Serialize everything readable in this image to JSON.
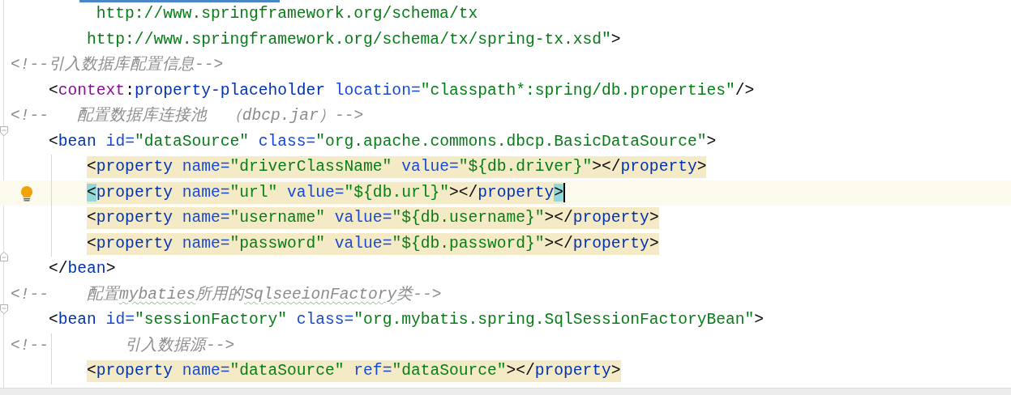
{
  "editor": {
    "lines": [
      {
        "tokens": [
          {
            "kind": "value",
            "text": "         http://www.springframework.org/schema/tx"
          }
        ]
      },
      {
        "tokens": [
          {
            "kind": "value",
            "text": "        http://www.springframework.org/schema/tx/spring-tx.xsd\""
          },
          {
            "kind": "punct",
            "text": ">"
          }
        ]
      },
      {
        "tokens": [
          {
            "kind": "comment",
            "text": "<!--引入数据库配置信息-->"
          }
        ]
      },
      {
        "tokens": [
          {
            "kind": "punct",
            "text": "    <"
          },
          {
            "kind": "namespace",
            "text": "context"
          },
          {
            "kind": "punct",
            "text": ":"
          },
          {
            "kind": "tag",
            "text": "property-placeholder"
          },
          {
            "kind": "attr",
            "text": " location="
          },
          {
            "kind": "value",
            "text": "\"classpath*:spring/db.properties\""
          },
          {
            "kind": "punct",
            "text": "/>"
          }
        ]
      },
      {
        "tokens": [
          {
            "kind": "comment",
            "text": "<!--   配置数据库连接池  （dbcp.jar）-->"
          }
        ]
      },
      {
        "fold_start": true,
        "tokens": [
          {
            "kind": "punct",
            "text": "    <"
          },
          {
            "kind": "tag",
            "text": "bean"
          },
          {
            "kind": "attr",
            "text": " id="
          },
          {
            "kind": "value",
            "text": "\"dataSource\""
          },
          {
            "kind": "attr",
            "text": " class="
          },
          {
            "kind": "value",
            "text": "\"org.apache.commons.dbcp.BasicDataSource\""
          },
          {
            "kind": "punct",
            "text": ">"
          }
        ]
      },
      {
        "highlighted": true,
        "indent_guide": true,
        "tokens": [
          {
            "kind": "punct",
            "text": "        <"
          },
          {
            "kind": "tag",
            "text": "property"
          },
          {
            "kind": "attr",
            "text": " name="
          },
          {
            "kind": "value",
            "text": "\"driverClassName\""
          },
          {
            "kind": "attr",
            "text": " value="
          },
          {
            "kind": "value",
            "text": "\"${db.driver}\""
          },
          {
            "kind": "punct",
            "text": "></"
          },
          {
            "kind": "tag",
            "text": "property"
          },
          {
            "kind": "punct",
            "text": ">"
          }
        ]
      },
      {
        "highlighted": true,
        "indent_guide": true,
        "current": true,
        "lightbulb": true,
        "tokens": [
          {
            "kind": "punct",
            "text": "        <",
            "matched": true
          },
          {
            "kind": "tag",
            "text": "property"
          },
          {
            "kind": "attr",
            "text": " name="
          },
          {
            "kind": "value",
            "text": "\"url\""
          },
          {
            "kind": "attr",
            "text": " value="
          },
          {
            "kind": "value",
            "text": "\"${db.url}\""
          },
          {
            "kind": "punct",
            "text": "></"
          },
          {
            "kind": "tag",
            "text": "property"
          },
          {
            "kind": "punct",
            "text": ">",
            "matched": true
          }
        ]
      },
      {
        "highlighted": true,
        "indent_guide": true,
        "tokens": [
          {
            "kind": "punct",
            "text": "        <"
          },
          {
            "kind": "tag",
            "text": "property"
          },
          {
            "kind": "attr",
            "text": " name="
          },
          {
            "kind": "value",
            "text": "\"username\""
          },
          {
            "kind": "attr",
            "text": " value="
          },
          {
            "kind": "value",
            "text": "\"${db.username}\""
          },
          {
            "kind": "punct",
            "text": "></"
          },
          {
            "kind": "tag",
            "text": "property"
          },
          {
            "kind": "punct",
            "text": ">"
          }
        ]
      },
      {
        "highlighted": true,
        "indent_guide": true,
        "tokens": [
          {
            "kind": "punct",
            "text": "        <"
          },
          {
            "kind": "tag",
            "text": "property"
          },
          {
            "kind": "attr",
            "text": " name="
          },
          {
            "kind": "value",
            "text": "\"password\""
          },
          {
            "kind": "attr",
            "text": " value="
          },
          {
            "kind": "value",
            "text": "\"${db.password}\""
          },
          {
            "kind": "punct",
            "text": "></"
          },
          {
            "kind": "tag",
            "text": "property"
          },
          {
            "kind": "punct",
            "text": ">"
          }
        ]
      },
      {
        "fold_end": true,
        "tokens": [
          {
            "kind": "punct",
            "text": "    </"
          },
          {
            "kind": "tag",
            "text": "bean"
          },
          {
            "kind": "punct",
            "text": ">"
          }
        ]
      },
      {
        "tokens": [
          {
            "kind": "comment",
            "text": "<!--    配置"
          },
          {
            "kind": "typo",
            "text": "mybaties"
          },
          {
            "kind": "comment",
            "text": "所用的"
          },
          {
            "kind": "typo",
            "text": "SqlseeionFactory"
          },
          {
            "kind": "comment",
            "text": "类-->"
          }
        ]
      },
      {
        "fold_start": true,
        "tokens": [
          {
            "kind": "punct",
            "text": "    <"
          },
          {
            "kind": "tag",
            "text": "bean"
          },
          {
            "kind": "attr",
            "text": " id="
          },
          {
            "kind": "value",
            "text": "\"sessionFactory\""
          },
          {
            "kind": "attr",
            "text": " class="
          },
          {
            "kind": "value",
            "text": "\"org.mybatis.spring.SqlSessionFactoryBean\""
          },
          {
            "kind": "punct",
            "text": ">"
          }
        ]
      },
      {
        "indent_guide": true,
        "tokens": [
          {
            "kind": "comment",
            "text": "<!--        引入数据源-->"
          }
        ]
      },
      {
        "highlighted": true,
        "indent_guide": true,
        "tokens": [
          {
            "kind": "punct",
            "text": "        <"
          },
          {
            "kind": "tag",
            "text": "property"
          },
          {
            "kind": "attr",
            "text": " name="
          },
          {
            "kind": "value",
            "text": "\"dataSource\""
          },
          {
            "kind": "attr",
            "text": " ref="
          },
          {
            "kind": "value",
            "text": "\"dataSource\""
          },
          {
            "kind": "punct",
            "text": "></"
          },
          {
            "kind": "tag",
            "text": "property"
          },
          {
            "kind": "punct",
            "text": ">"
          }
        ]
      }
    ]
  }
}
